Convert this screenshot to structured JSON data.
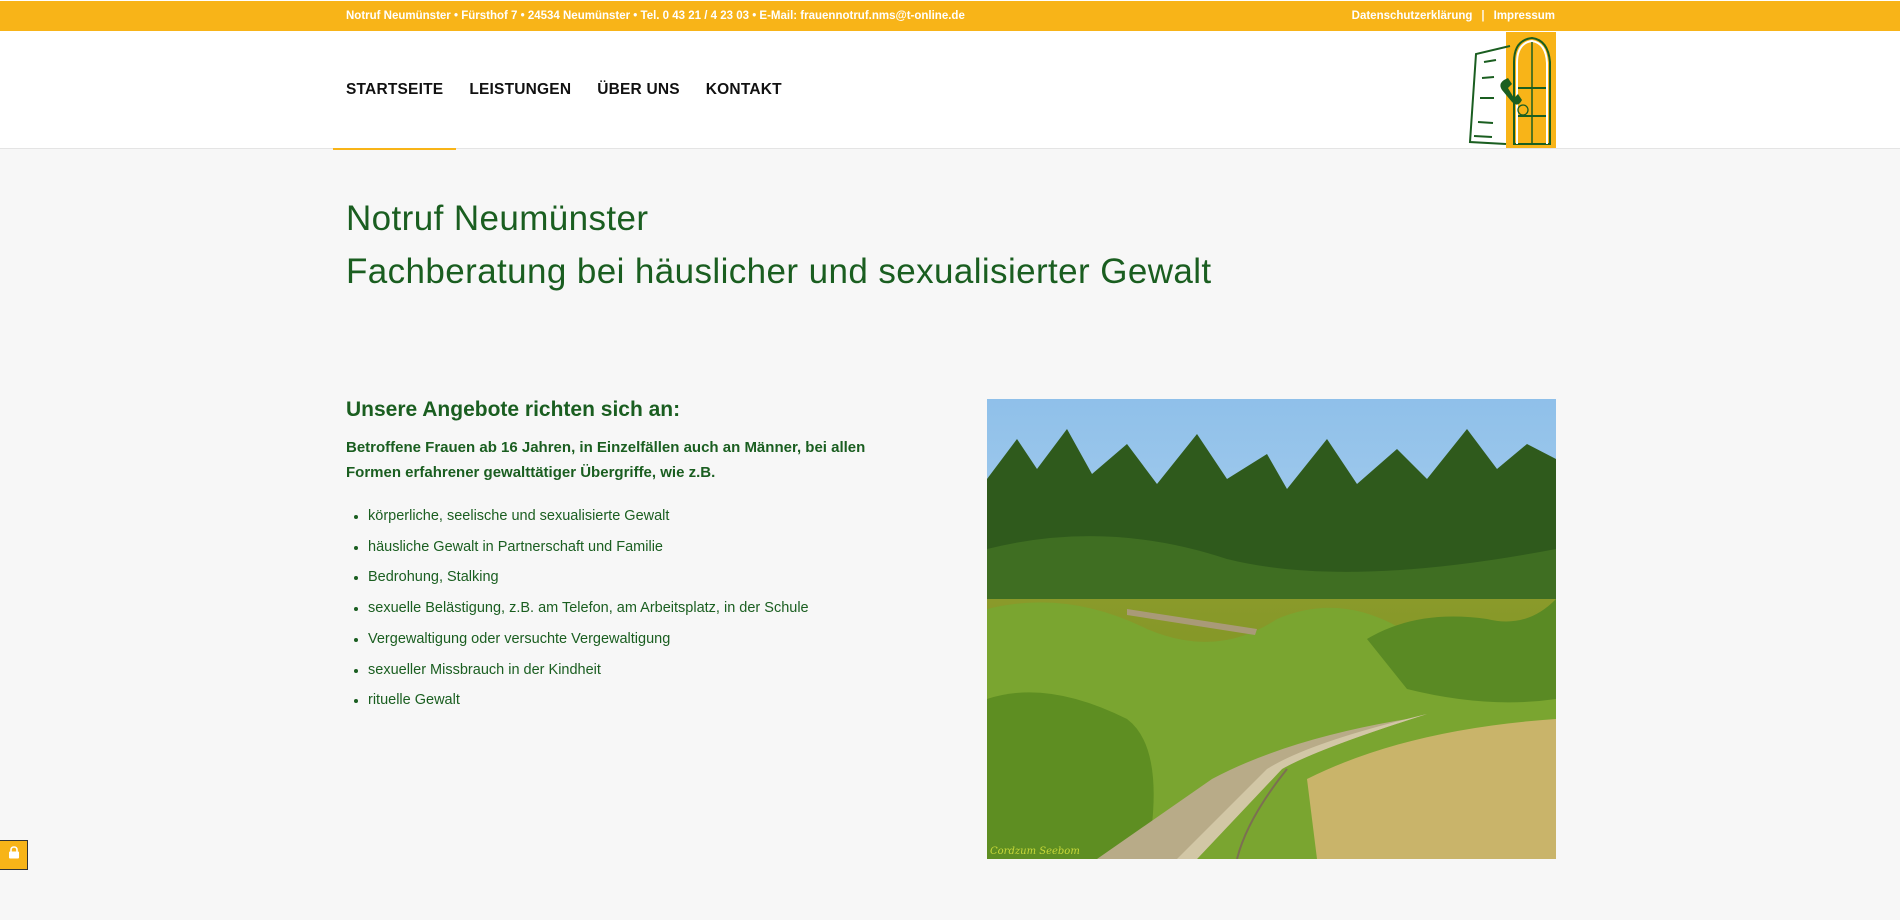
{
  "topbar": {
    "contact": "Notruf Neumünster • Fürsthof 7 • 24534 Neumünster • Tel. 0 43 21 / 4 23 03 • E-Mail: frauennotruf.nms@t-online.de",
    "links": [
      "Datenschutzerklärung",
      "Impressum"
    ]
  },
  "nav": {
    "items": [
      "STARTSEITE",
      "LEISTUNGEN",
      "ÜBER UNS",
      "KONTAKT"
    ],
    "active": "STARTSEITE"
  },
  "hero": {
    "title_line1": "Notruf Neumünster",
    "title_line2": "Fachberatung bei häuslicher und sexualisierter Gewalt"
  },
  "offers": {
    "heading": "Unsere Angebote richten sich an:",
    "intro": "Betroffene Frauen ab 16 Jahren, in Einzelfällen auch an Männer, bei allen Formen erfahrener gewalttätiger Übergriffe, wie z.B.",
    "items": [
      "körperliche, seelische und sexualisierte Gewalt",
      "häusliche Gewalt in Partnerschaft und Familie",
      "Bedrohung, Stalking",
      "sexuelle Belästigung, z.B. am Telefon, am Arbeitsplatz, in der Schule",
      "Vergewaltigung oder versuchte Vergewaltigung",
      "sexueller Missbrauch in der Kindheit",
      "rituelle Gewalt"
    ]
  },
  "photo": {
    "credit": "Cordzum Seebom"
  },
  "icons": {
    "logo": "window-phone-logo",
    "privacy": "lock-icon"
  },
  "colors": {
    "accent": "#f8b418",
    "text_green": "#1a5e20",
    "background": "#f7f7f7"
  }
}
